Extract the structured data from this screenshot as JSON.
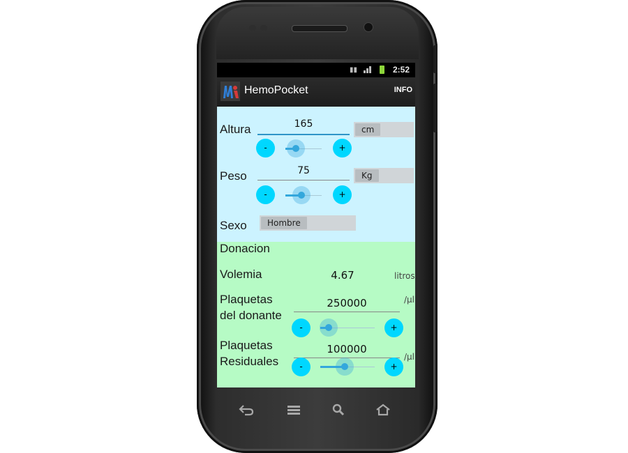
{
  "status_bar": {
    "time": "2:52",
    "icons": [
      "usb-debug-icon",
      "signal-icon",
      "battery-charging-icon"
    ]
  },
  "action_bar": {
    "app_title": "HemoPocket",
    "info_label": "INFO",
    "logo_icon": "hemopocket-logo-icon"
  },
  "inputs": {
    "altura": {
      "label": "Altura",
      "value": "165",
      "unit": "cm",
      "minus": "-",
      "plus": "+",
      "slider_fraction": 0.28
    },
    "peso": {
      "label": "Peso",
      "value": "75",
      "unit": "Kg",
      "minus": "-",
      "plus": "+",
      "slider_fraction": 0.45
    },
    "sexo": {
      "label": "Sexo",
      "value": "Hombre"
    }
  },
  "results": {
    "donacion_label": "Donacion",
    "volemia": {
      "label": "Volemia",
      "value": "4.67",
      "unit": "litros"
    },
    "plaquetas_donante": {
      "label_line1": "Plaquetas",
      "label_line2": "del donante",
      "value": "250000",
      "unit": "/µl",
      "minus": "-",
      "plus": "+",
      "slider_fraction": 0.15
    },
    "plaquetas_residuales": {
      "label_line1": "Plaquetas",
      "label_line2": "Residuales",
      "value": "100000",
      "unit": "/µl",
      "minus": "-",
      "plus": "+",
      "slider_fraction": 0.45
    }
  },
  "nav_buttons": [
    "back-icon",
    "home-icon-menu",
    "search-icon",
    "home-icon"
  ],
  "colors": {
    "input_panel": "#ccf3ff",
    "result_panel": "#b6fbc5",
    "round_button": "#00d7ff",
    "slider_accent": "#33a7dc",
    "action_bar": "#222222"
  }
}
